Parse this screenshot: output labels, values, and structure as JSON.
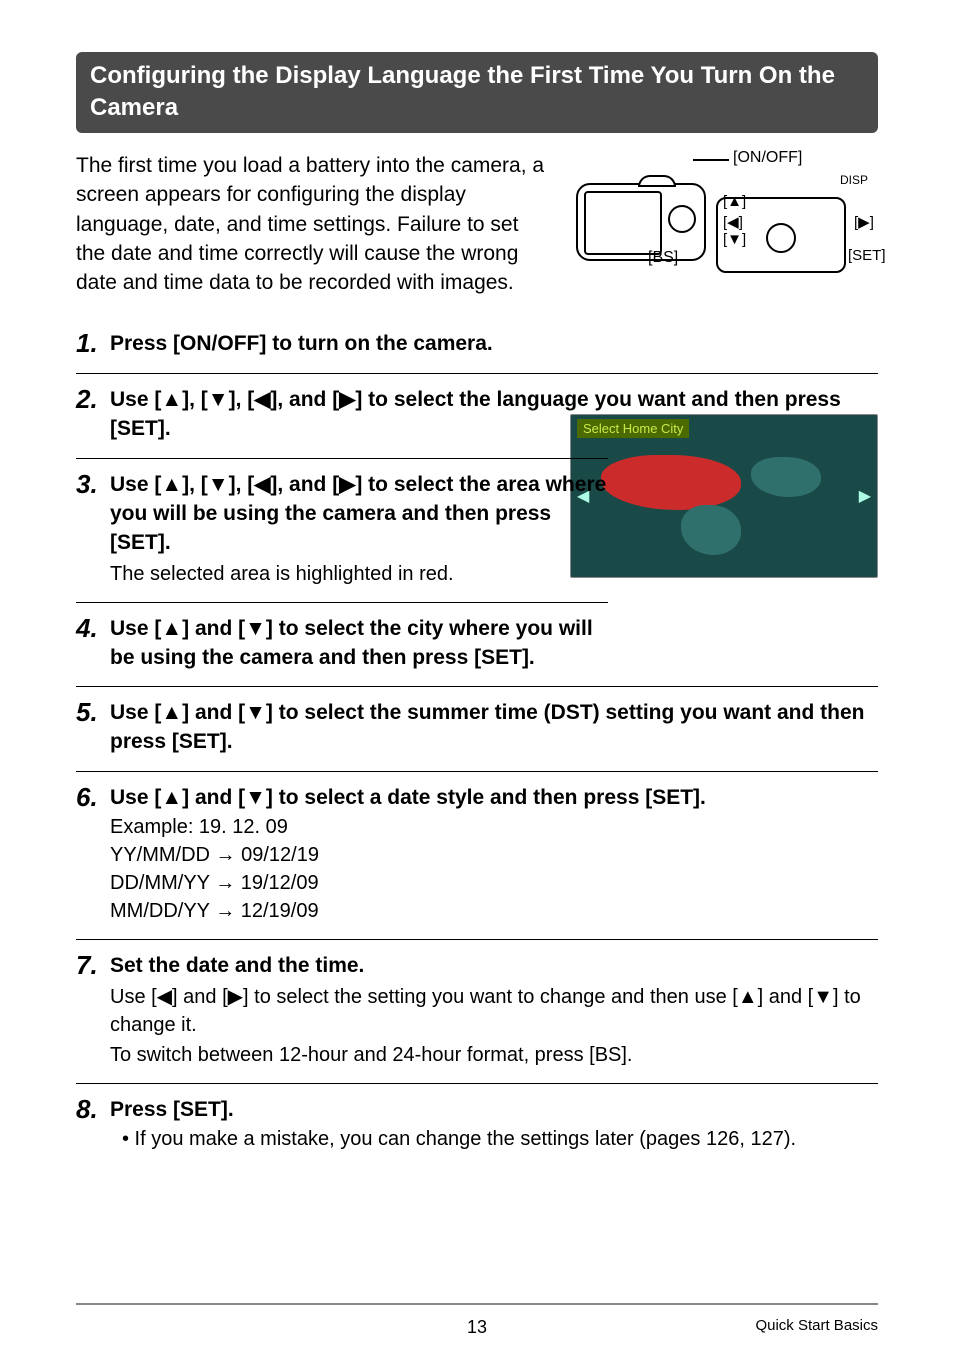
{
  "heading": "Configuring the Display Language the First Time You Turn On the Camera",
  "intro": "The first time you load a battery into the camera, a screen appears for configuring the display language, date, and time settings. Failure to set the date and time correctly will cause the wrong date and time data to be recorded with images.",
  "diagram": {
    "onoff": "[ON/OFF]",
    "bs": "[BS]",
    "disp": "DISP",
    "up": "[▲]",
    "left": "[◀]",
    "down": "[▼]",
    "right": "[▶]",
    "set": "[SET]"
  },
  "map_header": "Select Home City",
  "steps": {
    "s1": {
      "num": "1.",
      "title": "Press [ON/OFF] to turn on the camera."
    },
    "s2": {
      "num": "2.",
      "title": "Use [▲], [▼], [◀], and [▶] to select the language you want and then press [SET]."
    },
    "s3": {
      "num": "3.",
      "title": "Use [▲], [▼], [◀], and [▶] to select the area where you will be using the camera and then press [SET].",
      "sub": "The selected area is highlighted in red."
    },
    "s4": {
      "num": "4.",
      "title": "Use [▲] and [▼] to select the city where you will be using the camera and then press [SET]."
    },
    "s5": {
      "num": "5.",
      "title": "Use [▲] and [▼] to select the summer time (DST) setting you want and then press [SET]."
    },
    "s6": {
      "num": "6.",
      "title": "Use [▲] and [▼] to select a date style and then press [SET].",
      "example": "Example: 19. 12. 09",
      "l1": "YY/MM/DD → 09/12/19",
      "l2": "DD/MM/YY → 19/12/09",
      "l3": "MM/DD/YY → 12/19/09"
    },
    "s7": {
      "num": "7.",
      "title": "Set the date and the time.",
      "sub1": "Use [◀] and [▶] to select the setting you want to change and then use [▲] and [▼] to change it.",
      "sub2": "To switch between 12-hour and 24-hour format, press [BS]."
    },
    "s8": {
      "num": "8.",
      "title": "Press [SET].",
      "bullet": "• If you make a mistake, you can change the settings later (pages 126, 127)."
    }
  },
  "footer": {
    "page": "13",
    "section": "Quick Start Basics"
  }
}
